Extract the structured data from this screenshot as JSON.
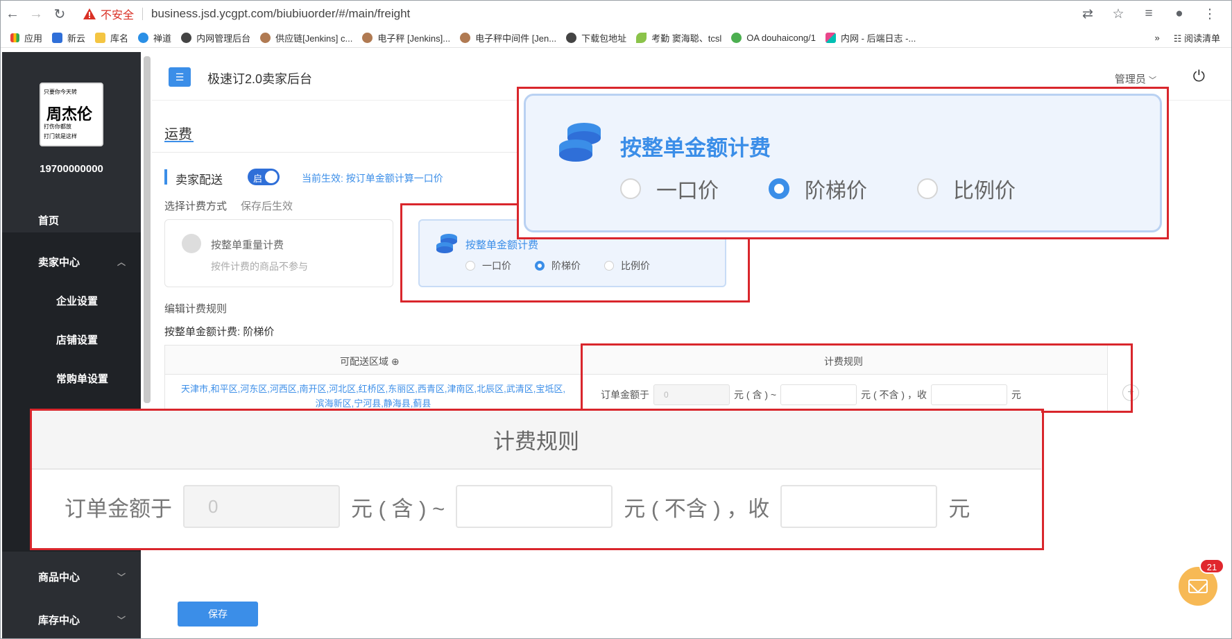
{
  "browser": {
    "insecure_label": "不安全",
    "url": "business.jsd.ycgpt.com/biubiuorder/#/main/freight",
    "bookmarks": [
      "应用",
      "新云",
      "库名",
      "禅道",
      "内网管理后台",
      "供应链[Jenkins] c...",
      "电子秤 [Jenkins]...",
      "电子秤中间件 [Jen...",
      "下载包地址",
      "考勤 窦海聪、tcsl",
      "OA douhaicong/1",
      "内网 - 后端日志 -..."
    ],
    "bookmark_overflow": "»",
    "reading_list": "阅读清单"
  },
  "sidebar": {
    "phone": "19700000000",
    "logo_big": "周杰伦",
    "logo_line1": "只要你今天转",
    "logo_line2": "打伤你都放",
    "logo_line3": "打门就是这样",
    "items": [
      {
        "label": "首页"
      },
      {
        "label": "卖家中心"
      },
      {
        "label": "企业设置"
      },
      {
        "label": "店铺设置"
      },
      {
        "label": "常购单设置"
      },
      {
        "label": "商品中心"
      },
      {
        "label": "库存中心"
      }
    ]
  },
  "header": {
    "menu_icon": "☰",
    "title": "极速订2.0卖家后台",
    "admin": "管理员",
    "admin_chevron": "﹀",
    "power_icon": "⏻"
  },
  "page": {
    "tab": "运费",
    "section_title": "卖家配送",
    "toggle_label": "启",
    "current_effect": "当前生效: 按订单金额计算一口价",
    "method_label": "选择计费方式",
    "method_hint": "保存后生效",
    "weight_card": {
      "title": "按整单重量计费",
      "desc": "按件计费的商品不参与"
    },
    "amount_card": {
      "title": "按整单金额计费",
      "options": [
        "一口价",
        "阶梯价",
        "比例价"
      ],
      "selected": 1
    },
    "edit_title": "编辑计费规则",
    "edit_sub": "按整单金额计费: 阶梯价",
    "table": {
      "col_region": "可配送区域",
      "col_rule": "计费规则",
      "region_text": "天津市,和平区,河东区,河西区,南开区,河北区,红桥区,东丽区,西青区,津南区,北辰区,武清区,宝坻区,滨海新区,宁河县,静海县,蓟县",
      "rule": {
        "prefix": "订单金额于",
        "from_value": "0",
        "mid1": "元 ( 含 ) ~",
        "mid2": "元 ( 不含 ) ，收",
        "suffix": "元"
      }
    },
    "save_label": "保存",
    "mail_badge": "21"
  },
  "colors": {
    "accent": "#3b8ee8",
    "sidebar": "#2b2e33",
    "highlight": "#d9262c"
  }
}
